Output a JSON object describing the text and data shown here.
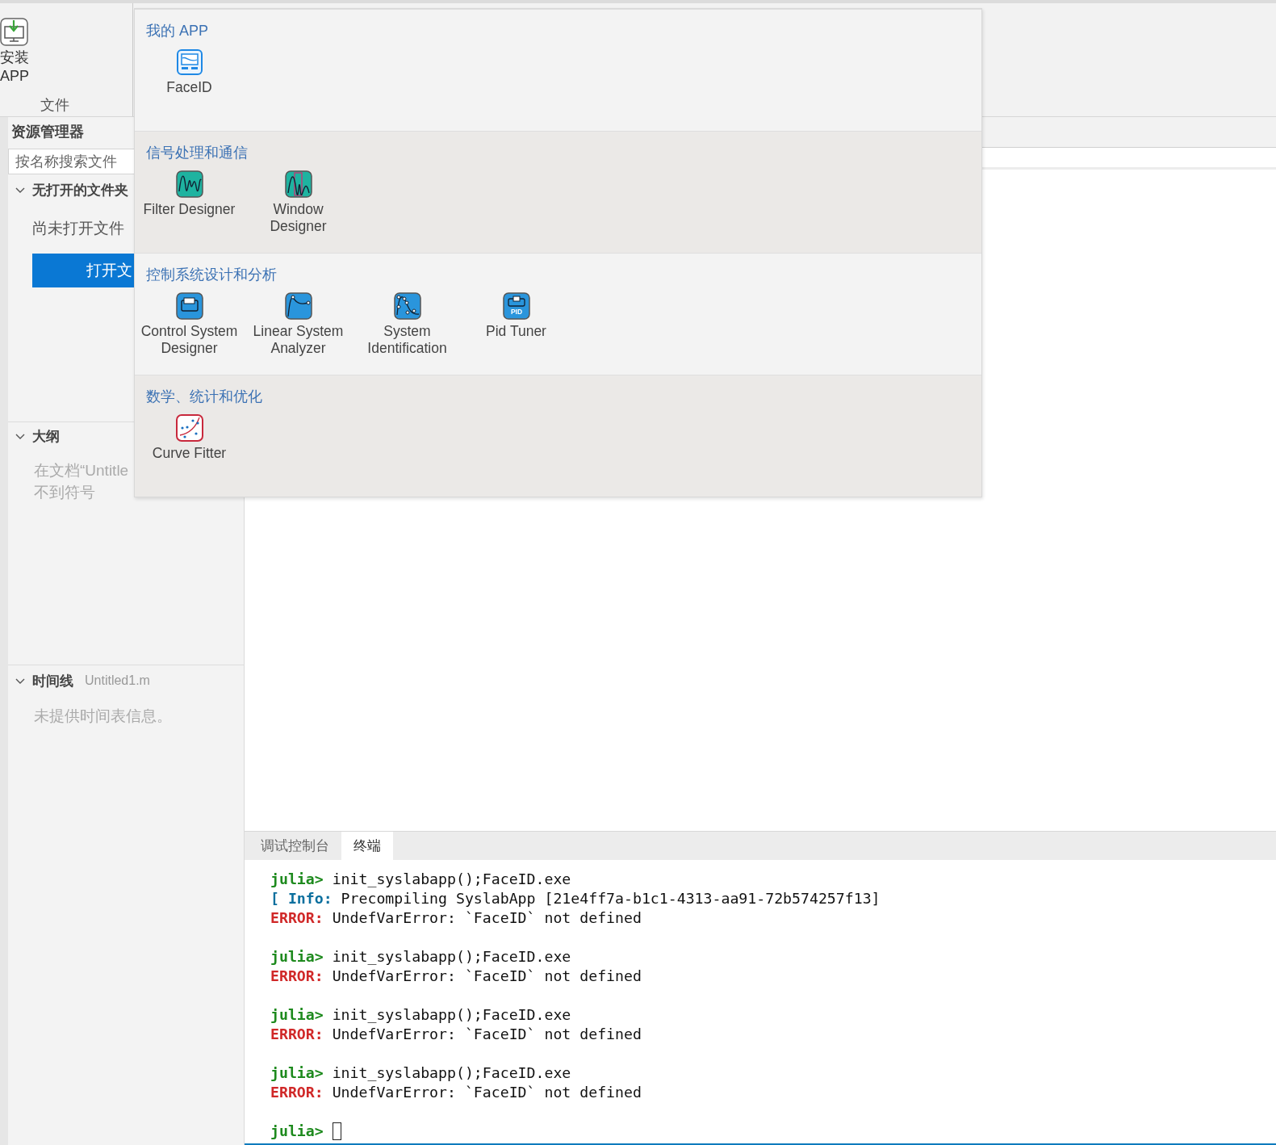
{
  "ribbon": {
    "install_button": {
      "label": "安装 APP"
    },
    "group_label": "文件"
  },
  "sidebar": {
    "title": "资源管理器",
    "search": {
      "placeholder": "按名称搜索文件"
    },
    "folders": {
      "title": "无打开的文件夹",
      "expanded": true,
      "message": "尚未打开文件",
      "button": "打开文"
    },
    "outline": {
      "title": "大纲",
      "expanded": true,
      "message_lines": [
        "在文档“Untitle",
        "不到符号"
      ]
    },
    "timeline": {
      "title": "时间线",
      "file": "Untitled1.m",
      "expanded": true,
      "message": "未提供时间表信息。"
    }
  },
  "panel": {
    "tabs": [
      {
        "label": "调试控制台",
        "selected": false
      },
      {
        "label": "终端",
        "selected": true
      }
    ],
    "terminal": {
      "blocks": [
        [
          {
            "kind": "prompt",
            "prefix": "julia>",
            "text": "init_syslabapp();FaceID.exe"
          },
          {
            "kind": "info",
            "prefix": "[ Info:",
            "text": "Precompiling SyslabApp [21e4ff7a-b1c1-4313-aa91-72b574257f13]"
          },
          {
            "kind": "error",
            "prefix": "ERROR:",
            "text": "UndefVarError: `FaceID` not defined"
          }
        ],
        [
          {
            "kind": "prompt",
            "prefix": "julia>",
            "text": "init_syslabapp();FaceID.exe"
          },
          {
            "kind": "error",
            "prefix": "ERROR:",
            "text": "UndefVarError: `FaceID` not defined"
          }
        ],
        [
          {
            "kind": "prompt",
            "prefix": "julia>",
            "text": "init_syslabapp();FaceID.exe"
          },
          {
            "kind": "error",
            "prefix": "ERROR:",
            "text": "UndefVarError: `FaceID` not defined"
          }
        ],
        [
          {
            "kind": "prompt",
            "prefix": "julia>",
            "text": "init_syslabapp();FaceID.exe"
          },
          {
            "kind": "error",
            "prefix": "ERROR:",
            "text": "UndefVarError: `FaceID` not defined"
          }
        ],
        [
          {
            "kind": "prompt",
            "prefix": "julia>",
            "cursor": true
          }
        ]
      ]
    }
  },
  "app_gallery": {
    "sections": [
      {
        "title": "我的 APP",
        "shaded": false,
        "apps": [
          {
            "label": "FaceID",
            "kind": "screen"
          }
        ]
      },
      {
        "title": "信号处理和通信",
        "shaded": true,
        "apps": [
          {
            "label": "Filter Designer",
            "kind": "wave"
          },
          {
            "label": "Window Designer",
            "kind": "window"
          }
        ]
      },
      {
        "title": "控制系统设计和分析",
        "shaded": false,
        "apps": [
          {
            "label": "Control System Designer",
            "kind": "block"
          },
          {
            "label": "Linear System Analyzer",
            "kind": "step"
          },
          {
            "label": "System Identification",
            "kind": "ident"
          },
          {
            "label": "Pid Tuner",
            "kind": "pid",
            "badge": "PID"
          }
        ]
      },
      {
        "title": "数学、统计和优化",
        "shaded": true,
        "apps": [
          {
            "label": "Curve Fitter",
            "kind": "fit"
          }
        ]
      }
    ]
  }
}
